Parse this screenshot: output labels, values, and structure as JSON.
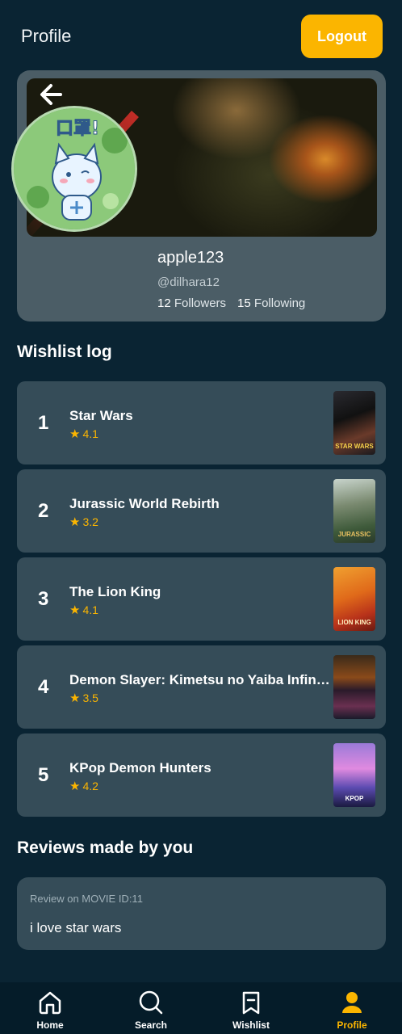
{
  "header": {
    "title": "Profile",
    "logout_label": "Logout"
  },
  "profile": {
    "username": "apple123",
    "handle": "@dilhara12",
    "followers_count": "12",
    "followers_label": "Followers",
    "following_count": "15",
    "following_label": "Following",
    "avatar_text": "口罩!"
  },
  "wishlist": {
    "title": "Wishlist log",
    "items": [
      {
        "rank": "1",
        "title": "Star Wars",
        "rating": "4.1",
        "poster_text": "STAR WARS"
      },
      {
        "rank": "2",
        "title": "Jurassic World Rebirth",
        "rating": "3.2",
        "poster_text": "JURASSIC"
      },
      {
        "rank": "3",
        "title": "The Lion King",
        "rating": "4.1",
        "poster_text": "LION KING"
      },
      {
        "rank": "4",
        "title": "Demon Slayer: Kimetsu no Yaiba Infinity Castle",
        "rating": "3.5",
        "poster_text": ""
      },
      {
        "rank": "5",
        "title": "KPop Demon Hunters",
        "rating": "4.2",
        "poster_text": "KPOP"
      }
    ]
  },
  "reviews": {
    "title": "Reviews made by you",
    "items": [
      {
        "meta": "Review on MOVIE ID:11",
        "text": "i love star wars"
      }
    ]
  },
  "nav": {
    "home": "Home",
    "search": "Search",
    "wishlist": "Wishlist",
    "profile": "Profile"
  },
  "colors": {
    "background": "#0a2433",
    "accent": "#fbb500",
    "card": "#354c58"
  }
}
